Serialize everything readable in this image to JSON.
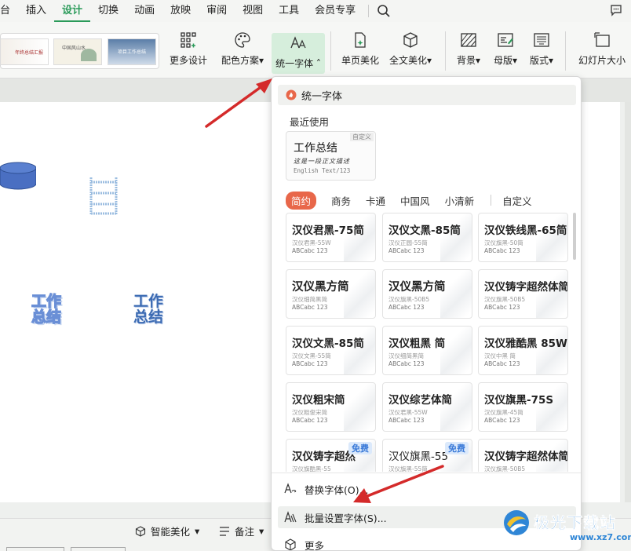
{
  "menu": {
    "tabs": [
      "台",
      "插入",
      "设计",
      "切换",
      "动画",
      "放映",
      "审阅",
      "视图",
      "工具",
      "会员专享"
    ],
    "active_tab": "设计"
  },
  "ribbon": {
    "theme_thumbs": [
      "年终总结汇报",
      "中国风山水",
      "项目工作总结"
    ],
    "more_design": "更多设计",
    "color_scheme": "配色方案",
    "unify_font": "统一字体",
    "single_page_beautify": "单页美化",
    "full_text_beautify": "全文美化",
    "background": "背景",
    "master": "母版",
    "layout": "版式",
    "slide_size": "幻灯片大小"
  },
  "slide": {
    "text_shape_1": "工作总结",
    "text_shape_2": "工作总结"
  },
  "status": {
    "smart_beautify": "智能美化",
    "notes": "备注"
  },
  "panel": {
    "title": "统一字体",
    "recent_label": "最近使用",
    "recent_card": {
      "title": "工作总结",
      "line2": "这是一段正文描述",
      "line3": "English Text/123",
      "tag": "自定义"
    },
    "categories": [
      "简约",
      "商务",
      "卡通",
      "中国风",
      "小清新"
    ],
    "active_category": "简约",
    "custom_category": "自定义",
    "fonts": [
      {
        "name": "汉仪君黑-75简",
        "sub": "汉仪君黑-55W",
        "abc": "ABCabc 123"
      },
      {
        "name": "汉仪文黑-85简",
        "sub": "汉仪正圆-55简",
        "abc": "ABCabc 123"
      },
      {
        "name": "汉仪铁线黑-65简",
        "sub": "汉仪旗黑-50简",
        "abc": "ABCabc 123"
      },
      {
        "name": "汉仪黑方简",
        "sub": "汉仪细简黑简",
        "abc": "ABCabc 123"
      },
      {
        "name": "汉仪黑方简",
        "sub": "汉仪旗黑-50B5",
        "abc": "ABCabc 123"
      },
      {
        "name": "汉仪铸字超然体简",
        "sub": "汉仪旗黑-50B5",
        "abc": "ABCabc 123"
      },
      {
        "name": "汉仪文黑-85简",
        "sub": "汉仪文黑-55简",
        "abc": "ABCabc 123"
      },
      {
        "name": "汉仪粗黑 简",
        "sub": "汉仪细简黑简",
        "abc": "ABCabc 123"
      },
      {
        "name": "汉仪雅酷黑 85W",
        "sub": "汉仪中黑 简",
        "abc": "ABCabc 123"
      },
      {
        "name": "汉仪粗宋简",
        "sub": "汉仪粗俊宋简",
        "abc": "ABCabc 123"
      },
      {
        "name": "汉仪综艺体简",
        "sub": "汉仪君黑-55W",
        "abc": "ABCabc 123"
      },
      {
        "name": "汉仪旗黑-75S",
        "sub": "汉仪旗黑-45简",
        "abc": "ABCabc 123"
      },
      {
        "name": "汉仪铸字超然",
        "sub": "汉仪旗酷黑-55",
        "abc": "ABCabc 123",
        "badge": "免费"
      },
      {
        "name": "汉仪旗黑-55",
        "sub": "汉仪旗黑-55简",
        "abc": "ABCabc 123",
        "badge": "免费"
      },
      {
        "name": "汉仪铸字超然体简",
        "sub": "汉仪旗黑-50B5",
        "abc": "ABCabc 123"
      }
    ],
    "replace_font": "替换字体(O)...",
    "batch_font": "批量设置字体(S)...",
    "more": "更多"
  },
  "watermark": {
    "brand": "极光下载站",
    "url": "www.xz7.com"
  },
  "colors": {
    "accent_green": "#2b9b5a",
    "category_active": "#e8674a",
    "arrow_red": "#d42a2a",
    "text_blue": "#3c6bb3"
  }
}
